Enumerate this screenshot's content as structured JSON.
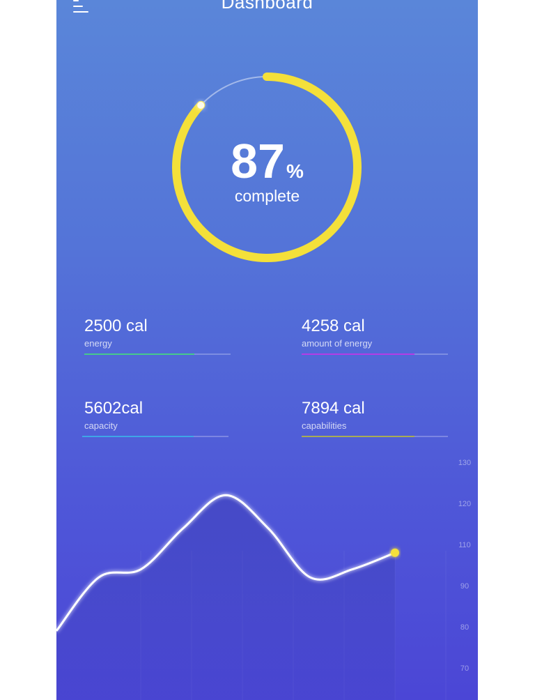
{
  "header": {
    "title": "Dashboard",
    "menu_icon": "menu-icon"
  },
  "progress": {
    "value": 87,
    "value_text": "87",
    "unit": "%",
    "label": "complete",
    "color": "#f4e03a"
  },
  "stats": [
    {
      "value": "2500 cal",
      "label": "energy",
      "fraction": 0.75,
      "color": "#47c98b"
    },
    {
      "value": "4258 cal",
      "label": "amount of energy",
      "fraction": 0.77,
      "color": "#b53ce6"
    },
    {
      "value": "5602cal",
      "label": "capacity",
      "fraction": 0.76,
      "color": "#3fa6e6"
    },
    {
      "value": "7894 cal",
      "label": "capabilities",
      "fraction": 0.77,
      "color": "#a8ab55"
    }
  ],
  "chart_data": {
    "type": "line",
    "y_ticks": [
      "130",
      "120",
      "110",
      "90",
      "80",
      "70"
    ],
    "points": [
      {
        "x": 0,
        "y": 79
      },
      {
        "x": 1,
        "y": 92
      },
      {
        "x": 2,
        "y": 94
      },
      {
        "x": 3,
        "y": 104
      },
      {
        "x": 4,
        "y": 112
      },
      {
        "x": 5,
        "y": 104
      },
      {
        "x": 6,
        "y": 92
      },
      {
        "x": 7,
        "y": 94
      },
      {
        "x": 8,
        "y": 98
      }
    ],
    "line_color": "#ffffff",
    "marker_color": "#f4e03a"
  }
}
